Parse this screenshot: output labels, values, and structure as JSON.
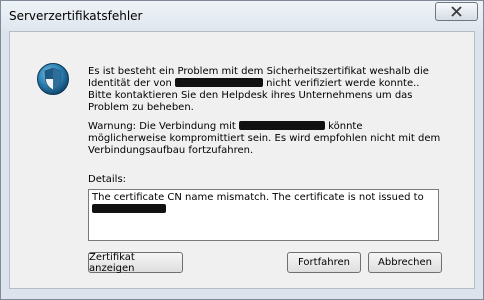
{
  "window": {
    "title": "Serverzertifikatsfehler"
  },
  "message": {
    "p1_part1": "Es ist besteht ein Problem mit dem Sicherheitszertifikat weshalb die Identität der von ",
    "p1_part2": " nicht verifiziert werde konnte.. Bitte kontaktieren Sie den Helpdesk ihres Unternehmens um das Problem zu beheben.",
    "p2_part1": "Warnung: Die Verbindung mit ",
    "p2_part2": " könnte möglicherweise kompromittiert sein. Es wird empfohlen nicht mit dem Verbindungsaufbau fortzufahren."
  },
  "details": {
    "label": "Details:",
    "text": "The certificate CN name mismatch. The certificate is not issued to"
  },
  "buttons": {
    "view_certificate": "Zertifikat anzeigen",
    "continue": "Fortfahren",
    "cancel": "Abbrechen"
  },
  "icons": {
    "close": "close-icon",
    "shield": "shield-icon"
  }
}
